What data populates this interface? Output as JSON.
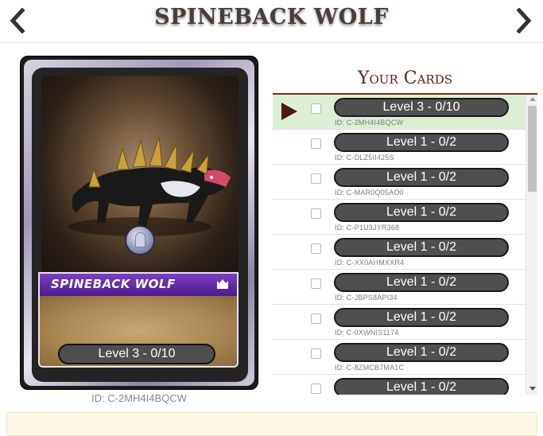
{
  "header": {
    "title": "SPINEBACK WOLF",
    "prev_icon": "chevron-left-icon",
    "next_icon": "chevron-right-icon"
  },
  "card": {
    "name": "SPINEBACK WOLF",
    "level_label": "Level 3 - 0/10",
    "id_label": "ID: C-2MH4I4BQCW",
    "gem_icon": "tombstone-icon",
    "cost_icon": "crown-icon",
    "banner_color": "#5a27a3"
  },
  "panel": {
    "title": "Your Cards",
    "selected_icon": "play-icon",
    "accent_color": "#7a2a1c",
    "selected_row_color": "#dcefd5",
    "rows": [
      {
        "level": "Level 3 - 0/10",
        "id": "ID: C-2MH4I4BQCW",
        "selected": true
      },
      {
        "level": "Level 1 - 0/2",
        "id": "ID: C-DLZ5II425S",
        "selected": false
      },
      {
        "level": "Level 1 - 0/2",
        "id": "ID: C-MAR0Q05AO0",
        "selected": false
      },
      {
        "level": "Level 1 - 0/2",
        "id": "ID: C-P1U3JYR368",
        "selected": false
      },
      {
        "level": "Level 1 - 0/2",
        "id": "ID: C-XX0AHMXXR4",
        "selected": false
      },
      {
        "level": "Level 1 - 0/2",
        "id": "ID: C-JBPS8API34",
        "selected": false
      },
      {
        "level": "Level 1 - 0/2",
        "id": "ID: C-0XWNIS1174",
        "selected": false
      },
      {
        "level": "Level 1 - 0/2",
        "id": "ID: C-8ZMCB7MA1C",
        "selected": false
      },
      {
        "level": "Level 1 - 0/2",
        "id": "",
        "selected": false
      }
    ]
  }
}
